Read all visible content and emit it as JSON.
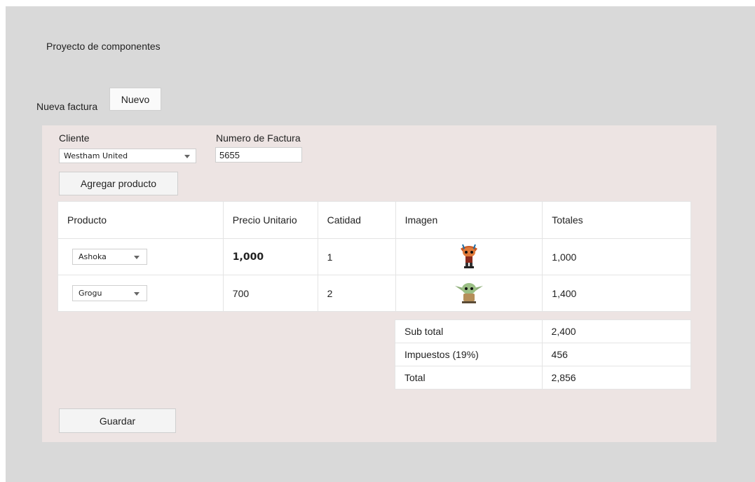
{
  "app": {
    "title": "Proyecto de componentes"
  },
  "toolbar": {
    "nueva_factura_label": "Nueva factura",
    "nuevo_label": "Nuevo"
  },
  "form": {
    "cliente_label": "Cliente",
    "cliente_value": "Westham United",
    "numero_label": "Numero de Factura",
    "numero_value": "5655",
    "agregar_label": "Agregar producto",
    "guardar_label": "Guardar"
  },
  "table": {
    "headers": [
      "Producto",
      "Precio Unitario",
      "Catidad",
      "Imagen",
      "Totales"
    ],
    "rows": [
      {
        "producto": "Ashoka",
        "precio": "1,000",
        "cantidad": "1",
        "imagen": "funko-ahsoka-figure-icon",
        "total": "1,000"
      },
      {
        "producto": "Grogu",
        "precio": "700",
        "cantidad": "2",
        "imagen": "funko-grogu-figure-icon",
        "total": "1,400"
      }
    ]
  },
  "summary": [
    {
      "label": "Sub total",
      "value": "2,400"
    },
    {
      "label": "Impuestos (19%)",
      "value": "456"
    },
    {
      "label": "Total",
      "value": "2,856"
    }
  ],
  "colors": {
    "app_bg": "#d9d9d9",
    "panel_bg": "#ede4e3",
    "table_bg": "#ffffff"
  }
}
